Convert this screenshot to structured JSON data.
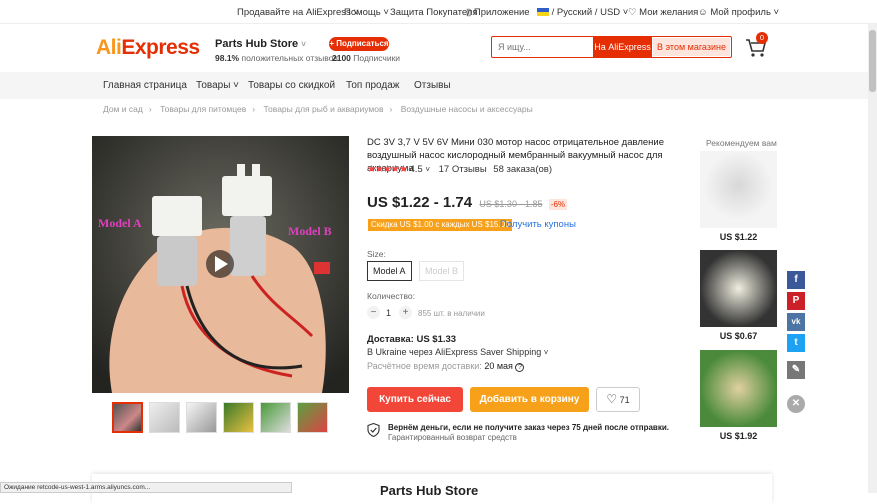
{
  "topbar": {
    "sell": "Продавайте на AliExpress",
    "help": "Помощь",
    "buyer_protection": "Защита Покупателя",
    "app": "Приложение",
    "lang": "/ Русский /",
    "currency": "USD",
    "wishlist": "Мои желания",
    "profile": "Мой профиль"
  },
  "header": {
    "logo_a": "Ali",
    "logo_b": "Express",
    "store_name": "Parts Hub Store",
    "positive_pct": "98.1%",
    "positive_label": "положительных отзывов",
    "subscribe": "+ Подписаться",
    "subs_count": "2100",
    "subs_label": "Подписчики",
    "search_placeholder": "Я ищу...",
    "btn_ali": "На AliExpress",
    "btn_store": "В этом магазине",
    "cart_count": "0"
  },
  "nav": {
    "items": [
      "Главная страница",
      "Товары",
      "Товары со скидкой",
      "Топ продаж",
      "Отзывы"
    ]
  },
  "breadcrumbs": [
    "Дом и сад",
    "Товары для питомцев",
    "Товары для рыб и аквариумов",
    "Воздушные насосы и аксессуары"
  ],
  "product": {
    "title": "DC 3V 3,7 V 5V 6V Мини 030 мотор насос отрицательное давление воздушный насос кислородный мембранный вакуумный насос для аквариума",
    "stars": "★★★★★",
    "rating": "4.5",
    "reviews": "17 Отзывы",
    "orders": "58 заказа(ов)",
    "price": "US $1.22 - 1.74",
    "old_price": "US $1.30 - 1.85",
    "discount": "-6%",
    "coupon": "Скидка US $1.00 с каждых US $15.00",
    "coupon_link": "Получить купоны",
    "size_label": "Size:",
    "size_a": "Model A",
    "size_b": "Model B",
    "qty_label": "Количество:",
    "qty_minus": "−",
    "qty_value": "1",
    "qty_plus": "+",
    "stock": "855 шт. в наличии",
    "delivery": "Доставка: US $1.33",
    "shipping": "В Ukraine через AliExpress Saver Shipping",
    "eta_label": "Расчётное время доставки:",
    "eta_date": "20 мая",
    "buy_now": "Купить сейчас",
    "add_to_cart": "Добавить в корзину",
    "wish_count": "71",
    "guarantee_title": "Вернём деньги, если не получите заказ через 75 дней после отправки.",
    "guarantee_sub": "Гарантированный возврат средств",
    "image_label_a": "Model A",
    "image_label_b": "Model B"
  },
  "recommended": {
    "title": "Рекомендуем вам",
    "prices": [
      "US $1.22",
      "US $0.67",
      "US $1.92"
    ]
  },
  "share": {
    "facebook": "f",
    "pinterest": "P",
    "vk": "vk",
    "twitter": "t"
  },
  "footer": {
    "store_name": "Parts Hub Store",
    "status": "Ожидание retcode-us-west-1.arms.aliyuncs.com..."
  },
  "colors": {
    "accent": "#e62e04",
    "buy": "#f24638",
    "cart": "#f7a11a",
    "link": "#2a73e0"
  }
}
